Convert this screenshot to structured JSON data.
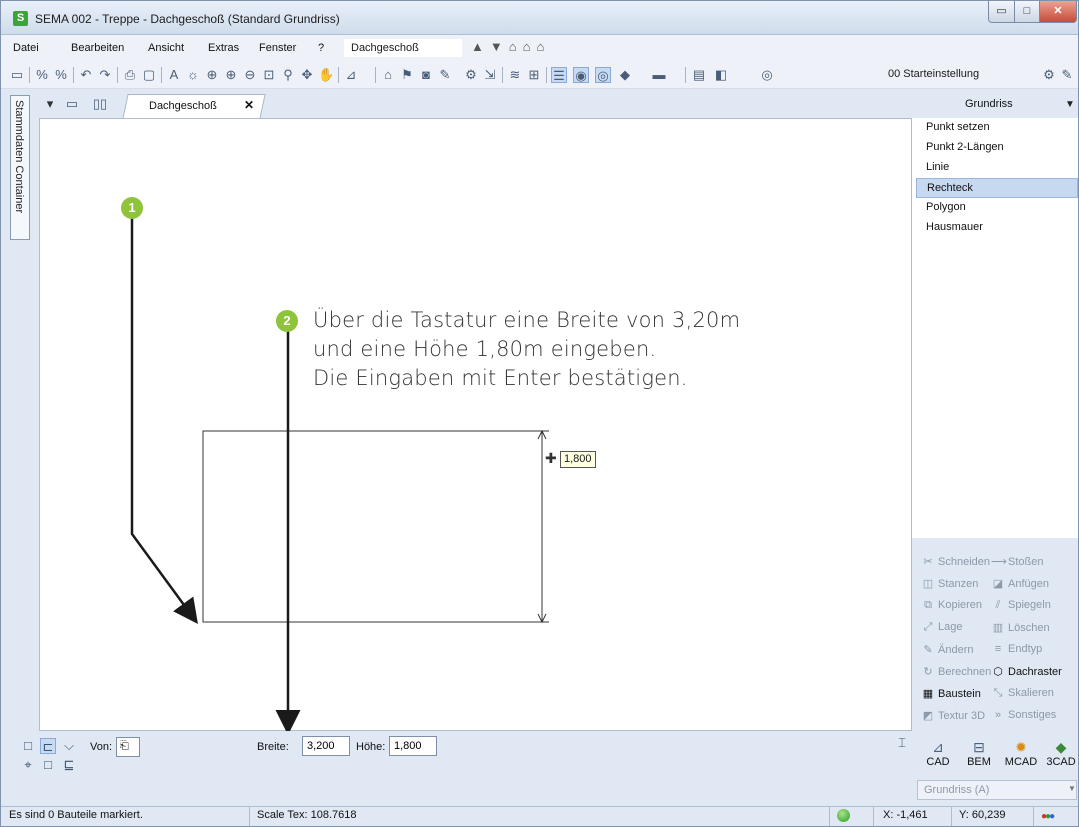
{
  "window": {
    "title": "SEMA  002 - Treppe  - Dachgeschoß (Standard Grundriss)",
    "logo": "S",
    "controls": [
      "minimize-icon",
      "maximize-icon",
      "close-icon"
    ],
    "minimize": "▭",
    "maximize": "□",
    "close": "✕"
  },
  "menu": {
    "datei": "Datei",
    "bearbeiten": "Bearbeiten",
    "ansicht": "Ansicht",
    "extras": "Extras",
    "fenster": "Fenster",
    "help": "?",
    "floor": "Dachgeschoß",
    "floor_arrows": "▲▼⌂⌂⌂"
  },
  "toolbar": {
    "layer_combo": "00 Starteinstellung"
  },
  "side_container": {
    "label": "Stammdaten Container"
  },
  "document_tab": {
    "label": "Dachgeschoß",
    "close": "✕"
  },
  "canvas": {
    "badge1": "1",
    "badge2": "2",
    "instruction": [
      "Über die Tastatur eine Breite von 3,20m",
      "und eine Höhe 1,80m eingeben.",
      "Die Eingaben mit Enter bestätigen."
    ],
    "dim_tooltip": "1,800"
  },
  "inputbar": {
    "von_label": "Von:",
    "breite_label": "Breite:",
    "breite_value": "3,200",
    "hoehe_label": "Höhe:",
    "hoehe_value": "1,800"
  },
  "right_panel": {
    "title": "Grundriss",
    "tools": [
      "Punkt setzen",
      "Punkt 2-Längen",
      "Linie",
      "Rechteck",
      "Polygon",
      "Hausmauer"
    ],
    "selected_tool": "Rechteck",
    "commands": {
      "schneiden": "Schneiden",
      "stossen": "Stoßen",
      "stanzen": "Stanzen",
      "anfuegen": "Anfügen",
      "kopieren": "Kopieren",
      "spiegeln": "Spiegeln",
      "lage": "Lage",
      "loeschen": "Löschen",
      "aendern": "Ändern",
      "endtyp": "Endtyp",
      "berechnen": "Berechnen",
      "dachraster": "Dachraster",
      "baustein": "Baustein",
      "skalieren": "Skalieren",
      "textur3d": "Textur 3D",
      "sonstiges": "Sonstiges"
    },
    "modes": {
      "cad": "CAD",
      "bem": "BEM",
      "mcad": "MCAD",
      "cad3": "3CAD"
    },
    "view_combo": "Grundriss (A)"
  },
  "status": {
    "message": "Es sind 0 Bauteile markiert.",
    "scale": "Scale Tex: 108.7618",
    "x": "X: -1,461",
    "y": "Y: 60,239"
  },
  "colors": {
    "accent_badge": "#8fc33a",
    "selection": "#c6d9f1",
    "chrome": "#dfe8f3"
  }
}
